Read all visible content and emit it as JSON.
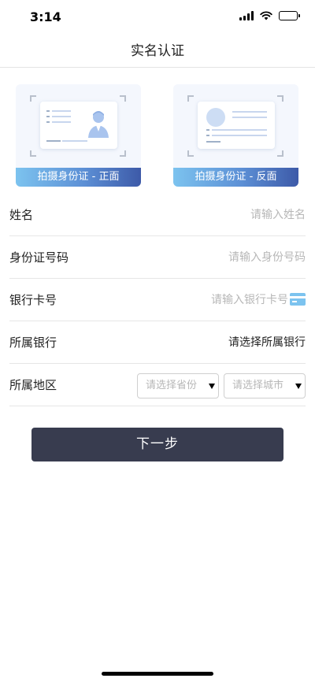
{
  "status_bar": {
    "time": "3:14"
  },
  "nav": {
    "title": "实名认证"
  },
  "id_cards": {
    "front_label": "拍摄身份证 - 正面",
    "back_label": "拍摄身份证 - 反面"
  },
  "form": {
    "name": {
      "label": "姓名",
      "placeholder": "请输入姓名"
    },
    "id_number": {
      "label": "身份证号码",
      "placeholder": "请输入身份号码"
    },
    "bank_card": {
      "label": "银行卡号",
      "placeholder": "请输入银行卡号"
    },
    "bank": {
      "label": "所属银行",
      "value": "请选择所属银行"
    },
    "region": {
      "label": "所属地区",
      "province_placeholder": "请选择省份",
      "city_placeholder": "请选择城市"
    }
  },
  "next_button": {
    "label": "下一步"
  },
  "colors": {
    "accent_dark": "#383c4f",
    "caption_gradient_start": "#7cc3ef",
    "caption_gradient_end": "#3d5aa8",
    "placeholder": "#b7b7b7"
  },
  "icons": [
    "cellular-signal-icon",
    "wifi-icon",
    "battery-icon",
    "bank-card-icon",
    "dropdown-arrow-icon",
    "person-avatar-icon"
  ]
}
